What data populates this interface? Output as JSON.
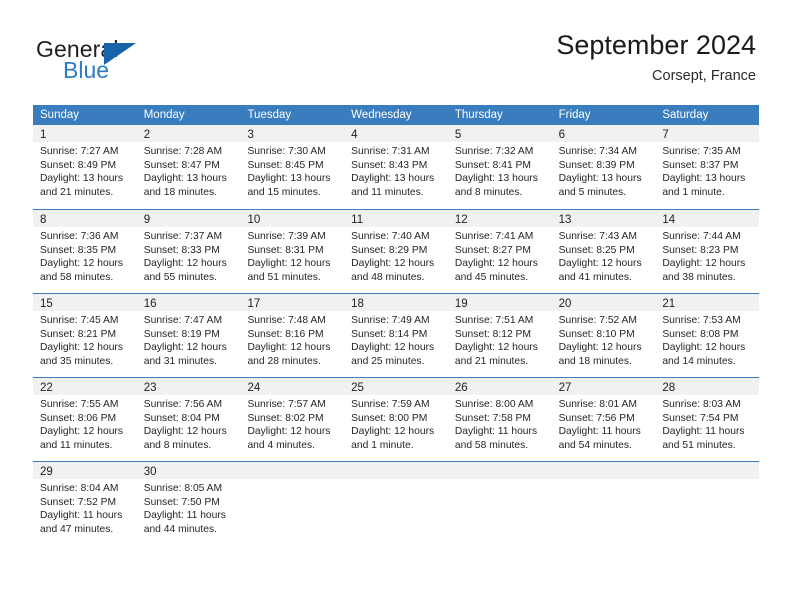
{
  "brand": {
    "name_part1": "General",
    "name_part2": "Blue",
    "flag_icon": "triangle-flag-icon"
  },
  "header": {
    "title": "September 2024",
    "subtitle": "Corsept, France"
  },
  "colors": {
    "header_blue": "#3a7dbf",
    "brand_blue": "#2b7cc4",
    "flag_blue": "#1665ab",
    "daynum_band": "#f1f1f1",
    "text": "#262626"
  },
  "weekdays": [
    "Sunday",
    "Monday",
    "Tuesday",
    "Wednesday",
    "Thursday",
    "Friday",
    "Saturday"
  ],
  "weeks": [
    [
      {
        "day": "1",
        "sunrise": "Sunrise: 7:27 AM",
        "sunset": "Sunset: 8:49 PM",
        "daylight": "Daylight: 13 hours and 21 minutes."
      },
      {
        "day": "2",
        "sunrise": "Sunrise: 7:28 AM",
        "sunset": "Sunset: 8:47 PM",
        "daylight": "Daylight: 13 hours and 18 minutes."
      },
      {
        "day": "3",
        "sunrise": "Sunrise: 7:30 AM",
        "sunset": "Sunset: 8:45 PM",
        "daylight": "Daylight: 13 hours and 15 minutes."
      },
      {
        "day": "4",
        "sunrise": "Sunrise: 7:31 AM",
        "sunset": "Sunset: 8:43 PM",
        "daylight": "Daylight: 13 hours and 11 minutes."
      },
      {
        "day": "5",
        "sunrise": "Sunrise: 7:32 AM",
        "sunset": "Sunset: 8:41 PM",
        "daylight": "Daylight: 13 hours and 8 minutes."
      },
      {
        "day": "6",
        "sunrise": "Sunrise: 7:34 AM",
        "sunset": "Sunset: 8:39 PM",
        "daylight": "Daylight: 13 hours and 5 minutes."
      },
      {
        "day": "7",
        "sunrise": "Sunrise: 7:35 AM",
        "sunset": "Sunset: 8:37 PM",
        "daylight": "Daylight: 13 hours and 1 minute."
      }
    ],
    [
      {
        "day": "8",
        "sunrise": "Sunrise: 7:36 AM",
        "sunset": "Sunset: 8:35 PM",
        "daylight": "Daylight: 12 hours and 58 minutes."
      },
      {
        "day": "9",
        "sunrise": "Sunrise: 7:37 AM",
        "sunset": "Sunset: 8:33 PM",
        "daylight": "Daylight: 12 hours and 55 minutes."
      },
      {
        "day": "10",
        "sunrise": "Sunrise: 7:39 AM",
        "sunset": "Sunset: 8:31 PM",
        "daylight": "Daylight: 12 hours and 51 minutes."
      },
      {
        "day": "11",
        "sunrise": "Sunrise: 7:40 AM",
        "sunset": "Sunset: 8:29 PM",
        "daylight": "Daylight: 12 hours and 48 minutes."
      },
      {
        "day": "12",
        "sunrise": "Sunrise: 7:41 AM",
        "sunset": "Sunset: 8:27 PM",
        "daylight": "Daylight: 12 hours and 45 minutes."
      },
      {
        "day": "13",
        "sunrise": "Sunrise: 7:43 AM",
        "sunset": "Sunset: 8:25 PM",
        "daylight": "Daylight: 12 hours and 41 minutes."
      },
      {
        "day": "14",
        "sunrise": "Sunrise: 7:44 AM",
        "sunset": "Sunset: 8:23 PM",
        "daylight": "Daylight: 12 hours and 38 minutes."
      }
    ],
    [
      {
        "day": "15",
        "sunrise": "Sunrise: 7:45 AM",
        "sunset": "Sunset: 8:21 PM",
        "daylight": "Daylight: 12 hours and 35 minutes."
      },
      {
        "day": "16",
        "sunrise": "Sunrise: 7:47 AM",
        "sunset": "Sunset: 8:19 PM",
        "daylight": "Daylight: 12 hours and 31 minutes."
      },
      {
        "day": "17",
        "sunrise": "Sunrise: 7:48 AM",
        "sunset": "Sunset: 8:16 PM",
        "daylight": "Daylight: 12 hours and 28 minutes."
      },
      {
        "day": "18",
        "sunrise": "Sunrise: 7:49 AM",
        "sunset": "Sunset: 8:14 PM",
        "daylight": "Daylight: 12 hours and 25 minutes."
      },
      {
        "day": "19",
        "sunrise": "Sunrise: 7:51 AM",
        "sunset": "Sunset: 8:12 PM",
        "daylight": "Daylight: 12 hours and 21 minutes."
      },
      {
        "day": "20",
        "sunrise": "Sunrise: 7:52 AM",
        "sunset": "Sunset: 8:10 PM",
        "daylight": "Daylight: 12 hours and 18 minutes."
      },
      {
        "day": "21",
        "sunrise": "Sunrise: 7:53 AM",
        "sunset": "Sunset: 8:08 PM",
        "daylight": "Daylight: 12 hours and 14 minutes."
      }
    ],
    [
      {
        "day": "22",
        "sunrise": "Sunrise: 7:55 AM",
        "sunset": "Sunset: 8:06 PM",
        "daylight": "Daylight: 12 hours and 11 minutes."
      },
      {
        "day": "23",
        "sunrise": "Sunrise: 7:56 AM",
        "sunset": "Sunset: 8:04 PM",
        "daylight": "Daylight: 12 hours and 8 minutes."
      },
      {
        "day": "24",
        "sunrise": "Sunrise: 7:57 AM",
        "sunset": "Sunset: 8:02 PM",
        "daylight": "Daylight: 12 hours and 4 minutes."
      },
      {
        "day": "25",
        "sunrise": "Sunrise: 7:59 AM",
        "sunset": "Sunset: 8:00 PM",
        "daylight": "Daylight: 12 hours and 1 minute."
      },
      {
        "day": "26",
        "sunrise": "Sunrise: 8:00 AM",
        "sunset": "Sunset: 7:58 PM",
        "daylight": "Daylight: 11 hours and 58 minutes."
      },
      {
        "day": "27",
        "sunrise": "Sunrise: 8:01 AM",
        "sunset": "Sunset: 7:56 PM",
        "daylight": "Daylight: 11 hours and 54 minutes."
      },
      {
        "day": "28",
        "sunrise": "Sunrise: 8:03 AM",
        "sunset": "Sunset: 7:54 PM",
        "daylight": "Daylight: 11 hours and 51 minutes."
      }
    ],
    [
      {
        "day": "29",
        "sunrise": "Sunrise: 8:04 AM",
        "sunset": "Sunset: 7:52 PM",
        "daylight": "Daylight: 11 hours and 47 minutes."
      },
      {
        "day": "30",
        "sunrise": "Sunrise: 8:05 AM",
        "sunset": "Sunset: 7:50 PM",
        "daylight": "Daylight: 11 hours and 44 minutes."
      },
      {
        "day": "",
        "sunrise": "",
        "sunset": "",
        "daylight": ""
      },
      {
        "day": "",
        "sunrise": "",
        "sunset": "",
        "daylight": ""
      },
      {
        "day": "",
        "sunrise": "",
        "sunset": "",
        "daylight": ""
      },
      {
        "day": "",
        "sunrise": "",
        "sunset": "",
        "daylight": ""
      },
      {
        "day": "",
        "sunrise": "",
        "sunset": "",
        "daylight": ""
      }
    ]
  ]
}
